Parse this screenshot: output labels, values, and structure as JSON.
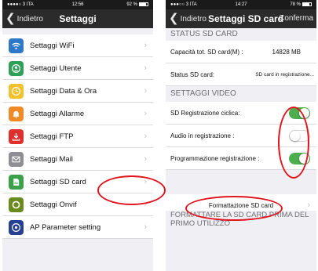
{
  "left": {
    "status": {
      "carrier": "●●●●○ 3 ITA",
      "time": "12:56",
      "battery": "92 %"
    },
    "nav": {
      "back": "Indietro",
      "title": "Settaggi"
    },
    "items": [
      {
        "label": "Settaggi WiFi",
        "icon": "wifi-icon",
        "color": "#2f78c7"
      },
      {
        "label": "Settaggi Utente",
        "icon": "user-icon",
        "color": "#2ea058"
      },
      {
        "label": "Settaggi Data & Ora",
        "icon": "clock-icon",
        "color": "#f2c12e"
      },
      {
        "label": "Settaggi Allarme",
        "icon": "bell-icon",
        "color": "#f08a24"
      },
      {
        "label": "Settaggi FTP",
        "icon": "download-icon",
        "color": "#e0302e"
      },
      {
        "label": "Settaggi Mail",
        "icon": "mail-icon",
        "color": "#8e8e93"
      },
      {
        "label": "Settaggi SD card",
        "icon": "sd-card-icon",
        "color": "#3aa14a"
      },
      {
        "label": "Settaggi Onvif",
        "icon": "onvif-icon",
        "color": "#6b8a1e"
      },
      {
        "label": "AP Parameter setting",
        "icon": "ap-icon",
        "color": "#26418f"
      }
    ]
  },
  "right": {
    "status": {
      "carrier": "●●●○○ 3 ITA",
      "time": "14:27",
      "battery": "78 %"
    },
    "nav": {
      "back": "Indietro",
      "title": "Settaggi SD card",
      "action": "Conferma"
    },
    "status_section": "STATUS SD CARD",
    "capacity": {
      "label": "Capacità tot. SD card(M) :",
      "value": "14828 MB"
    },
    "sd_status": {
      "label": "Status SD card:",
      "value": "SD card in registrazione..."
    },
    "video_section": "SETTAGGI VIDEO",
    "toggles": [
      {
        "label": "SD Registrazione ciclica:",
        "on": true
      },
      {
        "label": "Audio in registrazione :",
        "on": false
      },
      {
        "label": "Programmazione registrazione :",
        "on": true
      }
    ],
    "format_button": "Formattazione SD card",
    "footer_note": "FORMATTARE LA SD CARD PRIMA DEL PRIMO UTILIZZO"
  },
  "colors": {
    "annotation": "#e0141e",
    "toggle_on": "#4cae4c",
    "navbar": "#2b2b2b"
  }
}
